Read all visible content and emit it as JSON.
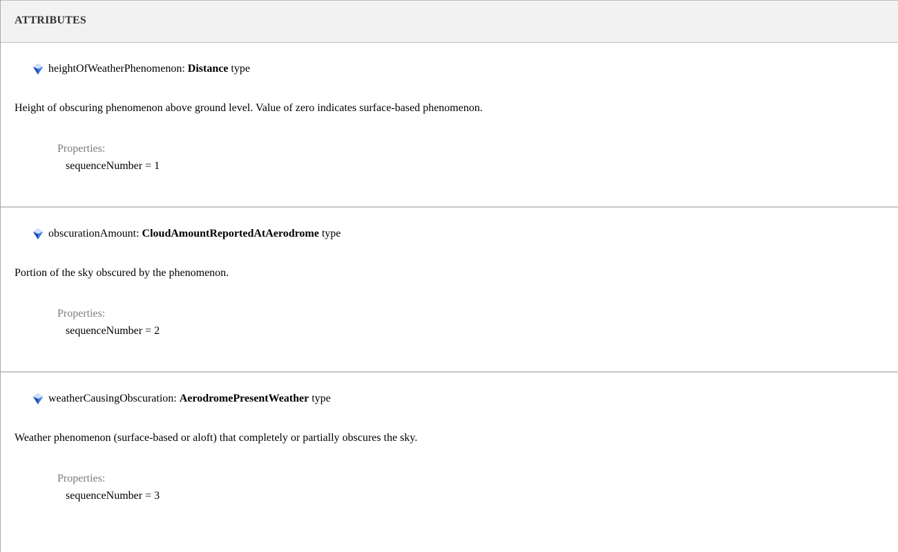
{
  "section": {
    "title": "ATTRIBUTES"
  },
  "attributes": [
    {
      "name": "heightOfWeatherPhenomenon:",
      "type": "Distance",
      "suffix": "type",
      "description": "Height of obscuring phenomenon above ground level. Value of zero indicates surface-based phenomenon.",
      "properties_label": "Properties:",
      "property": "sequenceNumber = 1"
    },
    {
      "name": "obscurationAmount:",
      "type": "CloudAmountReportedAtAerodrome",
      "suffix": "type",
      "description": "Portion of the sky obscured by the phenomenon.",
      "properties_label": "Properties:",
      "property": "sequenceNumber = 2"
    },
    {
      "name": "weatherCausingObscuration:",
      "type": "AerodromePresentWeather",
      "suffix": "type",
      "description": "Weather phenomenon (surface-based or aloft) that completely or partially obscures the sky.",
      "properties_label": "Properties:",
      "property": "sequenceNumber = 3"
    }
  ],
  "icons": {
    "attribute": "attribute-gem-icon"
  },
  "colors": {
    "header_bg": "#f2f2f2",
    "divider": "#c6c6c6",
    "properties_label": "#7a7a7a",
    "gem_light": "#cfe0ff",
    "gem_dark": "#2f5fbf"
  }
}
